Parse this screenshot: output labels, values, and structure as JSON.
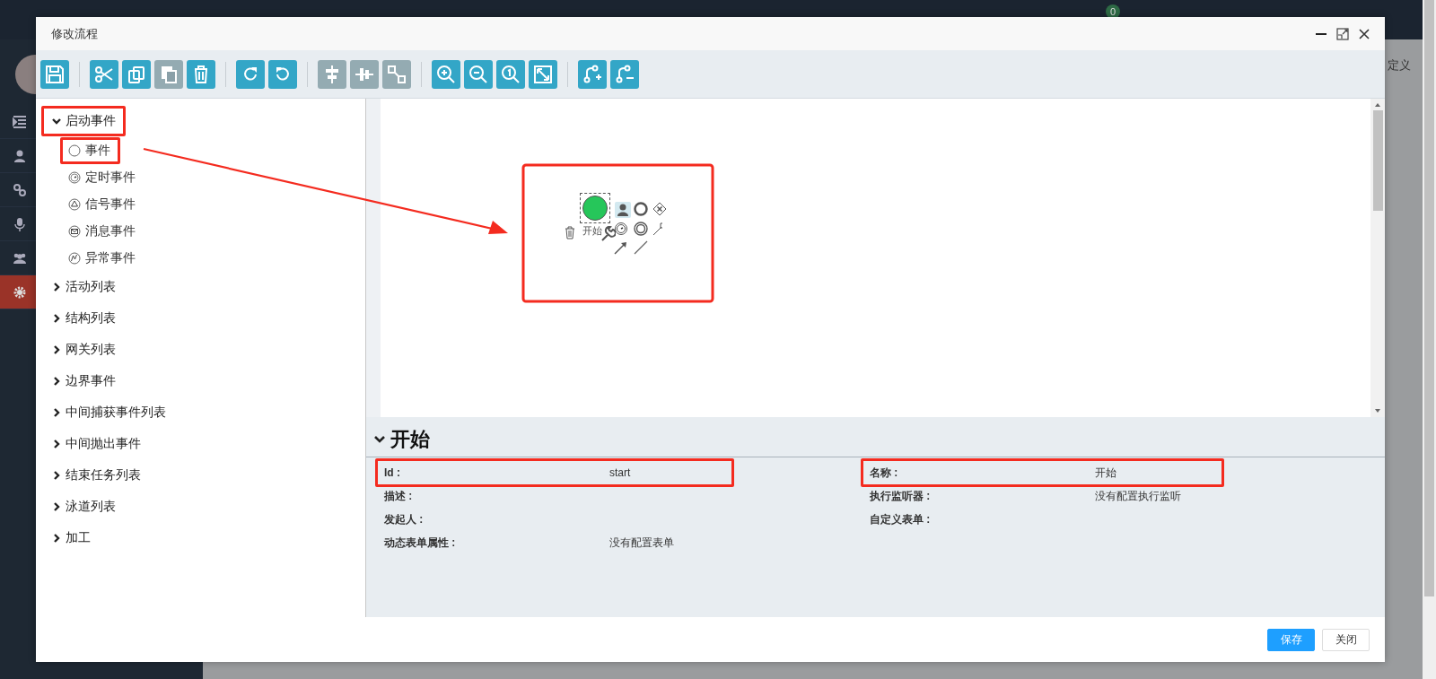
{
  "app": {
    "notification_count": "0",
    "tab_fragment": "定义",
    "sidebar": [
      {
        "kind": "indent",
        "selected": false
      },
      {
        "kind": "user",
        "selected": false
      },
      {
        "kind": "link",
        "selected": false
      },
      {
        "kind": "mic",
        "selected": false
      },
      {
        "kind": "users",
        "selected": false
      },
      {
        "kind": "gear",
        "selected": true
      }
    ]
  },
  "dialog": {
    "title": "修改流程",
    "window_buttons": [
      {
        "kind": "minimize"
      },
      {
        "kind": "maximize"
      },
      {
        "kind": "close"
      }
    ]
  },
  "toolbar": [
    {
      "buttons": [
        {
          "kind": "save",
          "disabled": false
        }
      ]
    },
    {
      "buttons": [
        {
          "kind": "cut",
          "disabled": false
        },
        {
          "kind": "copy",
          "disabled": false
        },
        {
          "kind": "paste",
          "disabled": true
        },
        {
          "kind": "delete",
          "disabled": false
        }
      ]
    },
    {
      "buttons": [
        {
          "kind": "redo",
          "disabled": false
        },
        {
          "kind": "undo",
          "disabled": false
        }
      ]
    },
    {
      "buttons": [
        {
          "kind": "align-h",
          "disabled": true
        },
        {
          "kind": "align-v",
          "disabled": true
        },
        {
          "kind": "distribute",
          "disabled": true
        }
      ]
    },
    {
      "buttons": [
        {
          "kind": "zoom-in",
          "disabled": false
        },
        {
          "kind": "zoom-out",
          "disabled": false
        },
        {
          "kind": "zoom-reset",
          "disabled": false
        },
        {
          "kind": "fit",
          "disabled": false
        }
      ]
    },
    {
      "buttons": [
        {
          "kind": "add-flow",
          "disabled": false
        },
        {
          "kind": "remove-flow",
          "disabled": false
        }
      ]
    }
  ],
  "palette": [
    {
      "label": "启动事件",
      "expanded": true,
      "highlighted": true,
      "children": [
        {
          "label": "事件",
          "kind": "none",
          "highlighted": true
        },
        {
          "label": "定时事件",
          "kind": "timer",
          "highlighted": false
        },
        {
          "label": "信号事件",
          "kind": "signal",
          "highlighted": false
        },
        {
          "label": "消息事件",
          "kind": "message",
          "highlighted": false
        },
        {
          "label": "异常事件",
          "kind": "error",
          "highlighted": false
        }
      ]
    },
    {
      "label": "活动列表",
      "expanded": false,
      "highlighted": false
    },
    {
      "label": "结构列表",
      "expanded": false,
      "highlighted": false
    },
    {
      "label": "网关列表",
      "expanded": false,
      "highlighted": false
    },
    {
      "label": "边界事件",
      "expanded": false,
      "highlighted": false
    },
    {
      "label": "中间捕获事件列表",
      "expanded": false,
      "highlighted": false
    },
    {
      "label": "中间抛出事件",
      "expanded": false,
      "highlighted": false
    },
    {
      "label": "结束任务列表",
      "expanded": false,
      "highlighted": false
    },
    {
      "label": "泳道列表",
      "expanded": false,
      "highlighted": false
    },
    {
      "label": "加工",
      "expanded": false,
      "highlighted": false
    }
  ],
  "canvas": {
    "highlighted": true,
    "node": {
      "kind": "start",
      "label": "开始",
      "selected": true
    },
    "context_pad": [
      {
        "kind": "user-task",
        "selected": true
      },
      {
        "kind": "end-event",
        "selected": false
      },
      {
        "kind": "gateway",
        "selected": false
      },
      {
        "kind": "delete",
        "selected": false
      },
      {
        "kind": "wrench",
        "selected": false
      },
      {
        "kind": "timer",
        "selected": false
      },
      {
        "kind": "intermediate",
        "selected": false
      },
      {
        "kind": "annotation",
        "selected": false
      },
      {
        "kind": "connect",
        "selected": false
      },
      {
        "kind": "line",
        "selected": false
      }
    ]
  },
  "properties": {
    "title": "开始",
    "expanded": true,
    "fields": [
      {
        "label": "Id :",
        "value": "start",
        "highlighted": true
      },
      {
        "label": "名称 :",
        "value": "开始",
        "highlighted": true
      },
      {
        "label": "描述 :",
        "highlighted": false
      },
      {
        "label": "执行监听器 :",
        "value": "没有配置执行监听",
        "highlighted": false
      },
      {
        "label": "发起人 :",
        "highlighted": false
      },
      {
        "label": "自定义表单 :",
        "highlighted": false
      },
      {
        "label": "动态表单属性 :",
        "value": "没有配置表单",
        "highlighted": false
      }
    ]
  },
  "footer": {
    "buttons": [
      {
        "label": "保存",
        "kind": "primary"
      },
      {
        "label": "关闭",
        "kind": "default"
      }
    ]
  }
}
